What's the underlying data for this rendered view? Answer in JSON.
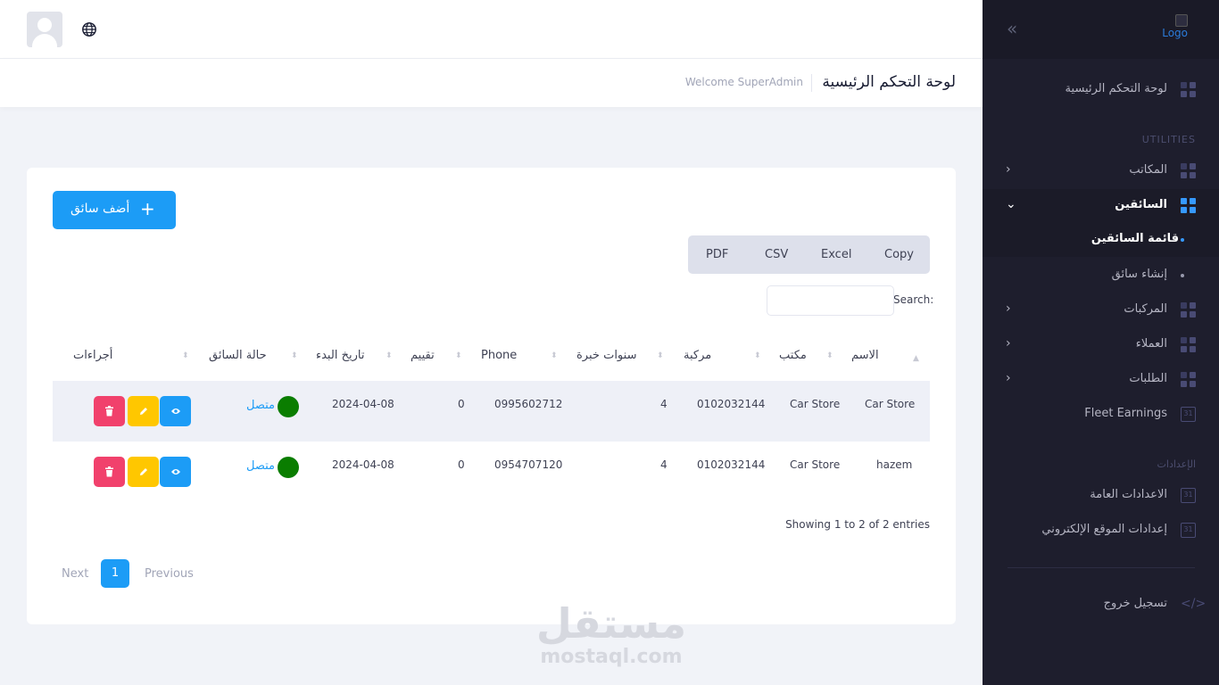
{
  "sidebar": {
    "logo_alt": "Logo",
    "collapse_icon": "double-chevron-left",
    "dashboard": "لوحة التحكم الرئيسية",
    "section_utilities": "UTILITIES",
    "offices": "المكاتب",
    "drivers": "السائقين",
    "drivers_list": "قائمة السائقين",
    "create_driver": "إنشاء سائق",
    "vehicles": "المركبات",
    "clients": "العملاء",
    "orders": "الطلبات",
    "fleet_earnings": "Fleet Earnings",
    "section_settings": "الإعدادات",
    "general_settings": "الاعدادات العامة",
    "website_settings": "إعدادات الموقع الإلكتروني",
    "logout": "تسجيل خروج",
    "calendar_icon_text": "31"
  },
  "header": {
    "page_title": "لوحة التحكم الرئيسية",
    "welcome": "Welcome SuperAdmin"
  },
  "toolbar": {
    "add_driver": "أضف سائق",
    "exports": [
      "Copy",
      "Excel",
      "CSV",
      "PDF"
    ],
    "search_label": "Search:",
    "search_value": ""
  },
  "table": {
    "columns": [
      "الاسم",
      "مكتب",
      "مركبة",
      "سنوات خبرة",
      "Phone",
      "تقييم",
      "تاريخ البدء",
      "حالة السائق",
      "أجراءات"
    ],
    "rows": [
      {
        "name": "Car Store",
        "office": "Car Store",
        "vehicle": "0102032144",
        "experience": "4",
        "phone": "0995602712",
        "rating": "0",
        "start_date": "2024-04-08",
        "status": "متصل"
      },
      {
        "name": "hazem",
        "office": "Car Store",
        "vehicle": "0102032144",
        "experience": "4",
        "phone": "0954707120",
        "rating": "0",
        "start_date": "2024-04-08",
        "status": "متصل"
      }
    ],
    "info": "Showing 1 to 2 of 2 entries"
  },
  "pagination": {
    "previous": "Previous",
    "current": "1",
    "next": "Next"
  },
  "watermark": {
    "arabic": "مستقل",
    "latin": "mostaql.com"
  },
  "colors": {
    "primary": "#1c9cf6",
    "danger": "#f1416c",
    "warning": "#ffc700",
    "status_online": "#0a7d00",
    "sidebar_bg": "#1e1e2d"
  }
}
